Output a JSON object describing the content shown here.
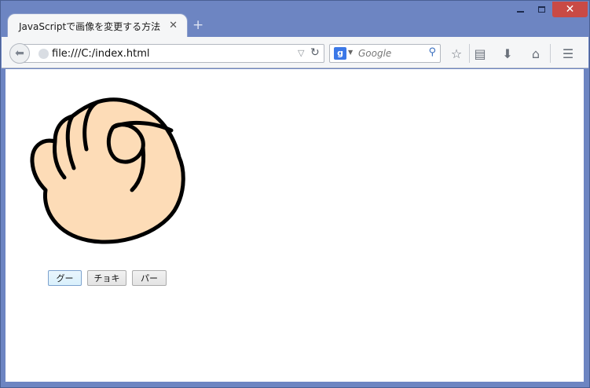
{
  "browser": {
    "tab_title": "JavaScriptで画像を変更する方法",
    "tab_close": "✕",
    "new_tab": "+",
    "url": "file:///C:/index.html",
    "search_engine_badge": "g",
    "search_placeholder": "Google"
  },
  "icons": [
    "back-arrow-icon",
    "globe-icon",
    "dropdown-icon",
    "reload-icon",
    "google-icon",
    "search-icon",
    "bookmark-star-icon",
    "reading-list-icon",
    "download-icon",
    "home-icon",
    "menu-icon"
  ],
  "page": {
    "image_alt": "グー",
    "buttons": [
      {
        "label": "グー"
      },
      {
        "label": "チョキ"
      },
      {
        "label": "パー"
      }
    ]
  },
  "colors": {
    "frame": "#6d85c2",
    "close": "#c94a45",
    "skin": "#fddcb7"
  }
}
